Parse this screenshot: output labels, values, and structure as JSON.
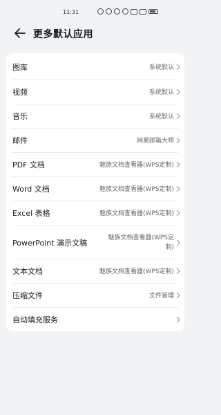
{
  "status": {
    "time": "11:31"
  },
  "header": {
    "title": "更多默认应用"
  },
  "items": [
    {
      "label": "图库",
      "value": "系统默认"
    },
    {
      "label": "视频",
      "value": "系统默认"
    },
    {
      "label": "音乐",
      "value": "系统默认"
    },
    {
      "label": "邮件",
      "value": "网易邮箱大师"
    },
    {
      "label": "PDF 文档",
      "value": "魅族文档查看器(WPS定制)"
    },
    {
      "label": "Word 文档",
      "value": "魅族文档查看器(WPS定制)"
    },
    {
      "label": "Excel 表格",
      "value": "魅族文档查看器(WPS定制)"
    },
    {
      "label": "PowerPoint 演示文稿",
      "value": "魅族文档查看器(WPS定制)"
    },
    {
      "label": "文本文档",
      "value": "魅族文档查看器(WPS定制)"
    },
    {
      "label": "压缩文件",
      "value": "文件管理"
    },
    {
      "label": "自动填充服务",
      "value": ""
    }
  ]
}
